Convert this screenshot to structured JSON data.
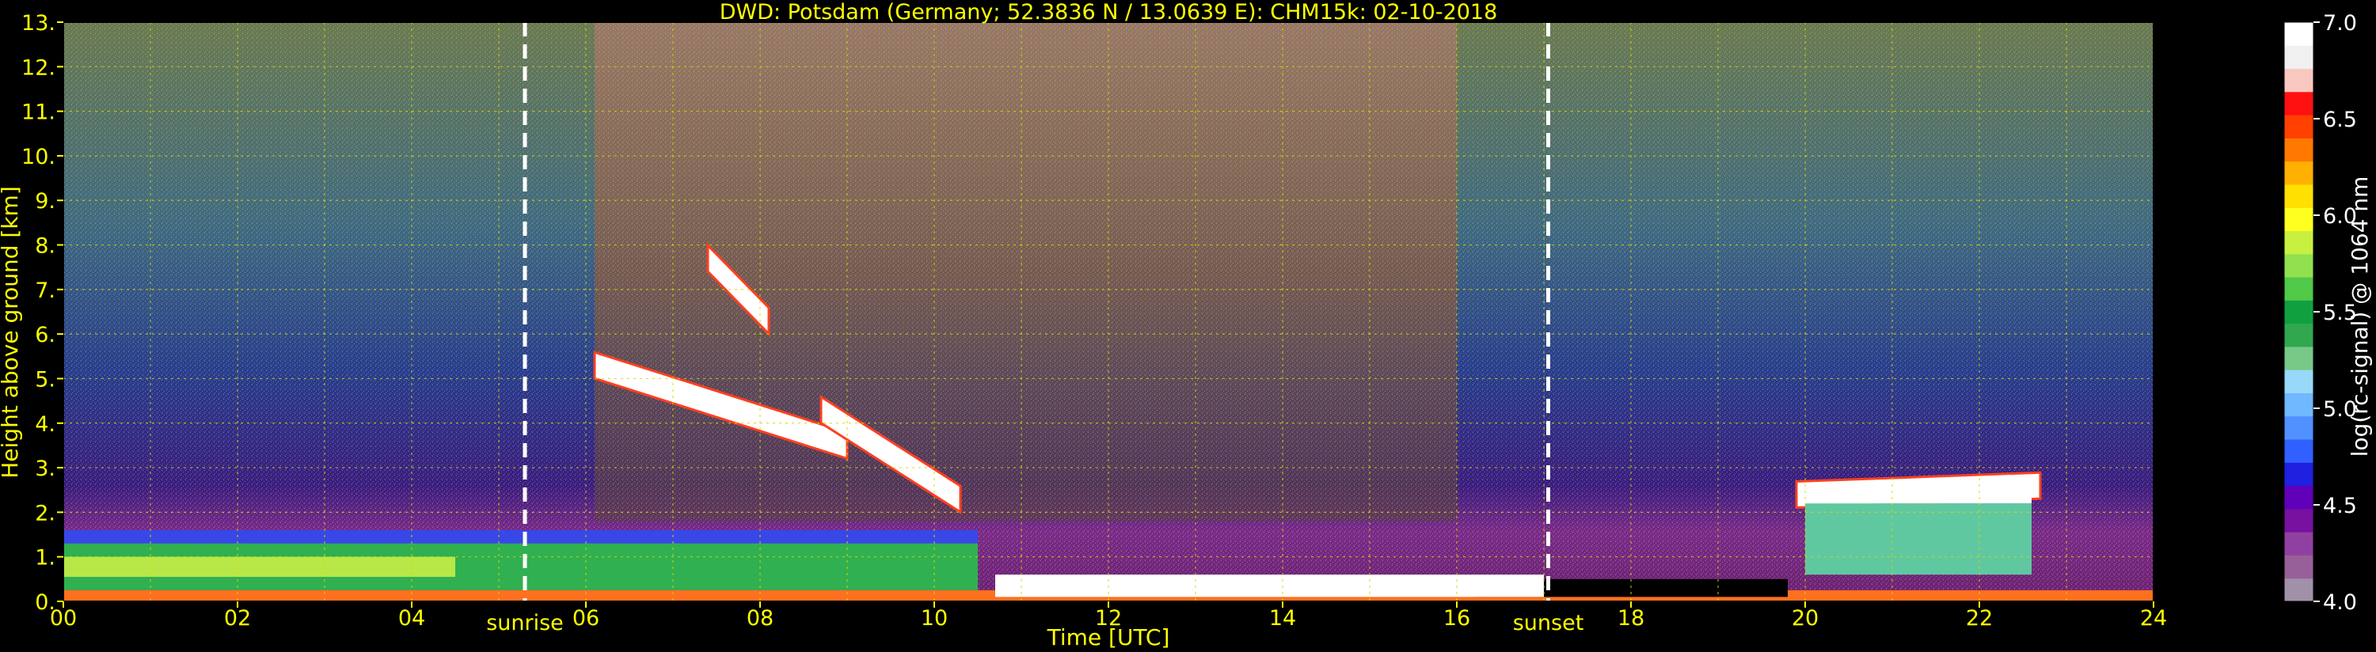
{
  "chart_data": {
    "type": "heatmap",
    "title": "DWD: Potsdam (Germany; 52.3836 N / 13.0639 E):    CHM15k: 02-10-2018",
    "xlabel": "Time [UTC]",
    "ylabel": "Height above ground [km]",
    "colorbar_label": "log(rc-signal) @ 1064 nm",
    "xlim": [
      0,
      24
    ],
    "ylim": [
      0,
      13
    ],
    "clim": [
      4.0,
      7.0
    ],
    "x_ticks": [
      "00",
      "02",
      "04",
      "06",
      "08",
      "10",
      "12",
      "14",
      "16",
      "18",
      "20",
      "22",
      "24"
    ],
    "y_ticks": [
      "0.",
      "1.",
      "2.",
      "3.",
      "4.",
      "5.",
      "6.",
      "7.",
      "8.",
      "9.",
      "10.",
      "11.",
      "12.",
      "13."
    ],
    "colorbar_ticks": [
      "4.0",
      "4.5",
      "5.0",
      "5.5",
      "6.0",
      "6.5",
      "7.0"
    ],
    "grid": true,
    "markers": [
      {
        "label": "sunrise",
        "time": 5.3
      },
      {
        "label": "sunset",
        "time": 17.05
      }
    ],
    "colormap": [
      "#a090a8",
      "#986098",
      "#9040a0",
      "#7810a0",
      "#6000b8",
      "#2020e0",
      "#3060ff",
      "#5090ff",
      "#70b8ff",
      "#98d8f8",
      "#78c888",
      "#30a850",
      "#10a040",
      "#50c848",
      "#90e050",
      "#c8f040",
      "#ffff20",
      "#ffe000",
      "#ffb000",
      "#ff7800",
      "#ff4000",
      "#ff1010",
      "#f8c8c0",
      "#f0f0f0",
      "#ffffff"
    ],
    "features": {
      "boundary_layer_top_km": 1.6,
      "cloud_layers": [
        {
          "start": 6.1,
          "end": 9.0,
          "base_km_start": 5.2,
          "base_km_end": 3.4
        },
        {
          "start": 7.4,
          "end": 8.1,
          "base_km_start": 7.6,
          "base_km_end": 6.2
        },
        {
          "start": 8.7,
          "end": 10.3,
          "base_km_start": 4.2,
          "base_km_end": 2.2
        },
        {
          "start": 19.9,
          "end": 22.7,
          "base_km_start": 2.3,
          "base_km_end": 2.5
        }
      ],
      "low_cloud": {
        "start": 10.7,
        "end": 17.0,
        "height_km": 0.6
      }
    }
  }
}
